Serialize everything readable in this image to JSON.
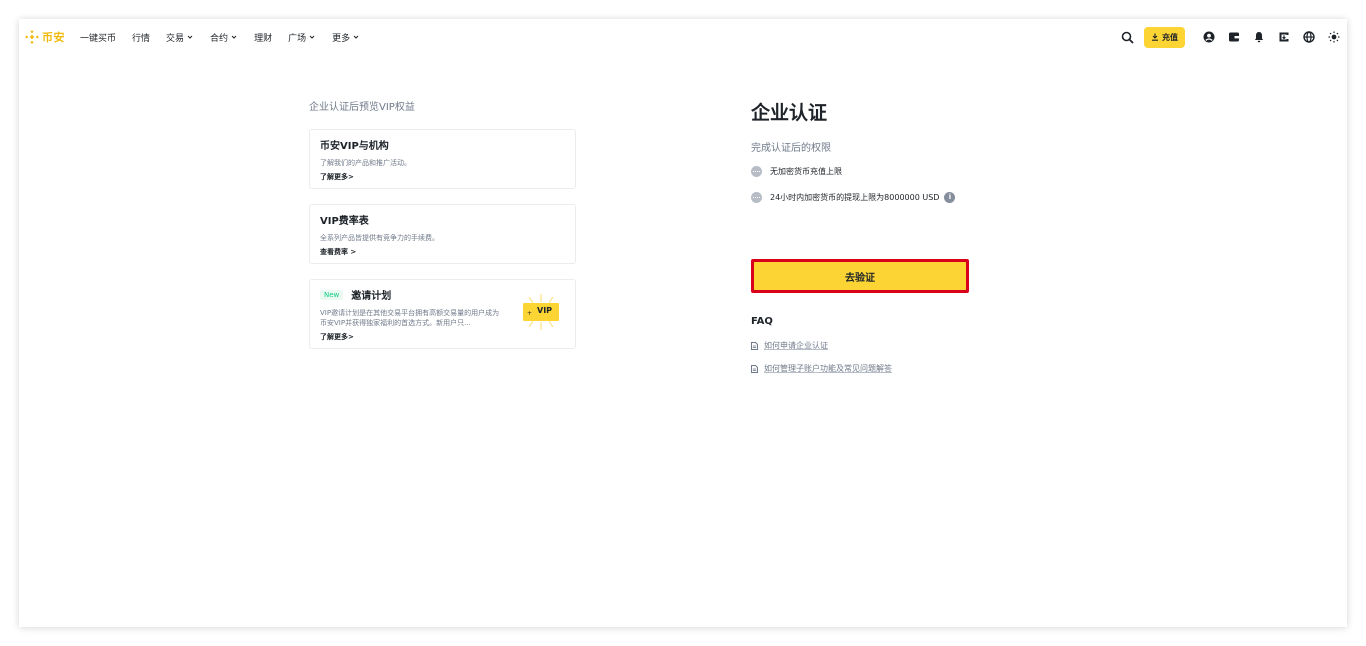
{
  "header": {
    "logo_text": "币安",
    "nav": [
      {
        "label": "一键买币",
        "has_dropdown": false
      },
      {
        "label": "行情",
        "has_dropdown": false
      },
      {
        "label": "交易",
        "has_dropdown": true
      },
      {
        "label": "合约",
        "has_dropdown": true
      },
      {
        "label": "理财",
        "has_dropdown": false
      },
      {
        "label": "广场",
        "has_dropdown": true
      },
      {
        "label": "更多",
        "has_dropdown": true
      }
    ],
    "deposit_label": "充值",
    "icons": [
      "search-icon",
      "download-icon",
      "user-icon",
      "wallet-icon",
      "bell-icon",
      "download-app-icon",
      "globe-icon",
      "theme-icon"
    ]
  },
  "left": {
    "section_title": "企业认证后预览VIP权益",
    "cards": [
      {
        "title": "币安VIP与机构",
        "desc": "了解我们的产品和推广活动。",
        "link": "了解更多>"
      },
      {
        "title": "VIP费率表",
        "desc": "全系列产品皆提供有竞争力的手续费。",
        "link": "查看费率 >"
      },
      {
        "badge": "New",
        "title": "邀请计划",
        "desc": "VIP邀请计划是在其他交易平台拥有高额交易量的用户成为币安VIP并获得独家福利的首选方式。新用户只...",
        "link": "了解更多>",
        "art_label": "VIP"
      }
    ]
  },
  "right": {
    "title": "企业认证",
    "benefits_heading": "完成认证后的权限",
    "benefits": [
      "无加密货币充值上限",
      "24小时内加密货币的提现上限为8000000 USD"
    ],
    "verify_button": "去验证",
    "faq_title": "FAQ",
    "faq_items": [
      "如何申请企业认证",
      "如何管理子账户功能及常见问题解答"
    ]
  },
  "colors": {
    "brand_yellow": "#fcd535",
    "logo_yellow": "#f0b90b",
    "highlight_red": "#d9001b",
    "text_primary": "#1e2329",
    "text_secondary": "#707a8a",
    "new_green": "#0ecb81"
  }
}
